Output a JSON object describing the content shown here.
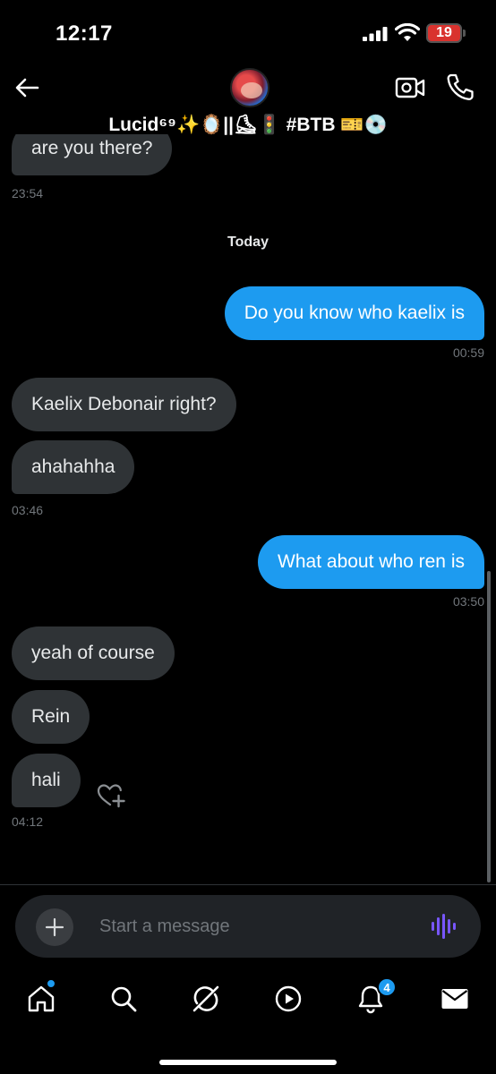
{
  "status_bar": {
    "time": "12:17",
    "battery_level": "19",
    "battery_color": "#d9322e"
  },
  "header": {
    "contact_name": "Lucid⁶⁹✨🪞||⛸🚦 #BTB 🎫💿",
    "icons": [
      "back-arrow-icon",
      "video-camera-icon",
      "phone-icon"
    ]
  },
  "messages": {
    "partial_top": {
      "text": "are you there?",
      "time": "23:54"
    },
    "date_separator": "Today",
    "items": [
      {
        "direction": "outgoing",
        "text": "Do you know who kaelix is",
        "time": "00:59"
      },
      {
        "direction": "incoming",
        "text": "Kaelix Debonair right?"
      },
      {
        "direction": "incoming",
        "text": "ahahahha",
        "time": "03:46"
      },
      {
        "direction": "outgoing",
        "text": "What about who ren is",
        "time": "03:50"
      },
      {
        "direction": "incoming",
        "text": "yeah of course"
      },
      {
        "direction": "incoming",
        "text": "Rein"
      },
      {
        "direction": "incoming",
        "text": "hali",
        "time": "04:12"
      }
    ]
  },
  "composer": {
    "placeholder": "Start a message"
  },
  "bottom_nav": {
    "items": [
      "home",
      "search",
      "grok",
      "video",
      "notifications",
      "messages"
    ],
    "notification_count": "4"
  },
  "colors": {
    "accent": "#1d9bf0",
    "incoming_bubble": "#2f3336",
    "background": "#000000",
    "voice_icon": "#7856ff"
  }
}
